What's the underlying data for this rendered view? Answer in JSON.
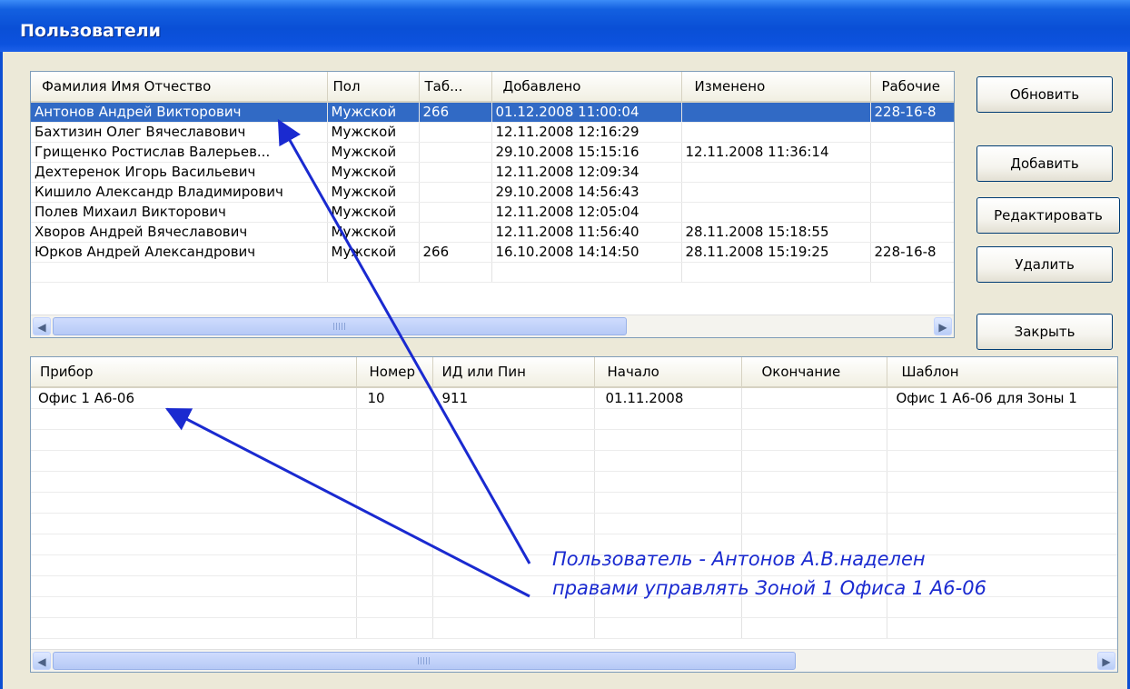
{
  "window": {
    "title": "Пользователи"
  },
  "users": {
    "columns": [
      "Фамилия Имя Отчество",
      "Пол",
      "Таб...",
      "Добавлено",
      "Изменено",
      "Рабочие"
    ],
    "rows": [
      {
        "name": "Антонов Андрей Викторович",
        "sex": "Мужской",
        "tab": "266",
        "added": "01.12.2008 11:00:04",
        "changed": "",
        "work": "228-16-8",
        "selected": true
      },
      {
        "name": "Бахтизин Олег Вячеславович",
        "sex": "Мужской",
        "tab": "",
        "added": "12.11.2008 12:16:29",
        "changed": "",
        "work": ""
      },
      {
        "name": "Грищенко Ростислав Валерьев...",
        "sex": "Мужской",
        "tab": "",
        "added": "29.10.2008 15:15:16",
        "changed": "12.11.2008 11:36:14",
        "work": ""
      },
      {
        "name": "Дехтеренок Игорь Васильевич",
        "sex": "Мужской",
        "tab": "",
        "added": "12.11.2008 12:09:34",
        "changed": "",
        "work": ""
      },
      {
        "name": "Кишило Александр Владимирович",
        "sex": "Мужской",
        "tab": "",
        "added": "29.10.2008 14:56:43",
        "changed": "",
        "work": ""
      },
      {
        "name": "Полев Михаил Викторович",
        "sex": "Мужской",
        "tab": "",
        "added": "12.11.2008 12:05:04",
        "changed": "",
        "work": ""
      },
      {
        "name": "Хворов Андрей Вячеславович",
        "sex": "Мужской",
        "tab": "",
        "added": "12.11.2008 11:56:40",
        "changed": "28.11.2008 15:18:55",
        "work": ""
      },
      {
        "name": "Юрков Андрей Александрович",
        "sex": "Мужской",
        "tab": "266",
        "added": "16.10.2008 14:14:50",
        "changed": "28.11.2008 15:19:25",
        "work": "228-16-8"
      }
    ]
  },
  "devices": {
    "columns": [
      "Прибор",
      "Номер",
      "ИД или Пин",
      "Начало",
      "Окончание",
      "Шаблон"
    ],
    "rows": [
      {
        "device": "Офис 1 А6-06",
        "number": "10",
        "id": "911",
        "start": "01.11.2008",
        "end": "",
        "template": "Офис 1 А6-06 для Зоны 1"
      }
    ]
  },
  "buttons": {
    "refresh": "Обновить",
    "add": "Добавить",
    "edit": "Редактировать",
    "delete": "Удалить",
    "close": "Закрыть"
  },
  "annotation": {
    "line1": "Пользователь - Антонов А.В.наделен",
    "line2": "правами управлять Зоной 1 Офиса 1 А6-06",
    "color": "#1a2ad0"
  },
  "icons": {
    "scroll_left": "chevron-left-icon",
    "scroll_right": "chevron-right-icon",
    "thumb_grip": "grip-icon"
  }
}
